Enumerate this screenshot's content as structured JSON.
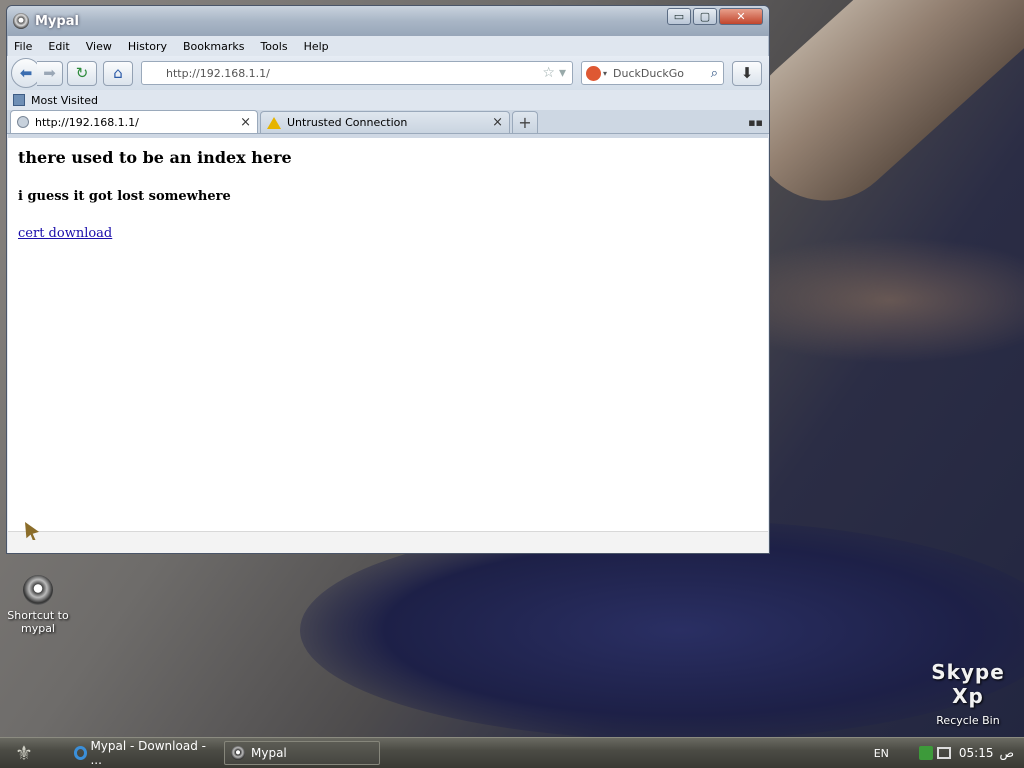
{
  "window": {
    "title": "Mypal",
    "controls": {
      "minimize": "▭",
      "maximize": "▢",
      "close": "✕"
    }
  },
  "menubar": [
    "File",
    "Edit",
    "View",
    "History",
    "Bookmarks",
    "Tools",
    "Help"
  ],
  "navbar": {
    "url": "http://192.168.1.1/",
    "search_placeholder": "DuckDuckGo",
    "icons": [
      "back-icon",
      "forward-icon",
      "reload-icon",
      "home-icon",
      "star-icon",
      "search-icon",
      "download-icon"
    ]
  },
  "bookmarks": {
    "most_visited": "Most Visited"
  },
  "tabs": [
    {
      "label": "http://192.168.1.1/",
      "active": true,
      "close": "×"
    },
    {
      "label": "Untrusted Connection",
      "active": false,
      "close": "×"
    }
  ],
  "page": {
    "heading": "there used to be an index here",
    "subheading": "i guess it got lost somewhere",
    "link": "cert download"
  },
  "desktop": {
    "shortcut_label": "Shortcut to mypal",
    "recycle_label": "Recycle Bin",
    "brand_text": "Skype Xp"
  },
  "taskbar": {
    "items": [
      "Mypal - Download - ...",
      "Mypal"
    ],
    "lang": "EN",
    "time": "05:15",
    "ampm": "ص"
  },
  "colors": {
    "link": "#1a0dab",
    "close_button": "#c1452b",
    "titlebar": "#a9b6c6"
  }
}
